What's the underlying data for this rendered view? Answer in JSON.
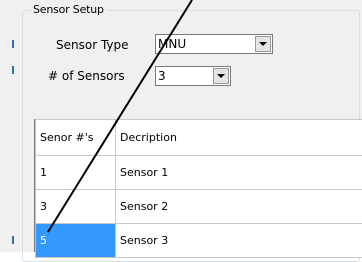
{
  "group": {
    "title": "Sensor Setup"
  },
  "sensor_type": {
    "label": "Sensor Type",
    "value": "MNU"
  },
  "num_sensors": {
    "label": "# of Sensors",
    "value": "3"
  },
  "table": {
    "columns": [
      "Senor #'s",
      "Decription"
    ],
    "rows": [
      {
        "num": "1",
        "desc": "Sensor 1"
      },
      {
        "num": "3",
        "desc": "Sensor 2"
      },
      {
        "num": "5",
        "desc": "Sensor 3"
      }
    ],
    "selected_row": 2
  },
  "colors": {
    "selection": "#3399ff",
    "window": "#f0f0f0",
    "accent": "#2e6fc1"
  },
  "icons": {
    "dropdown": "chevron-down-icon"
  }
}
